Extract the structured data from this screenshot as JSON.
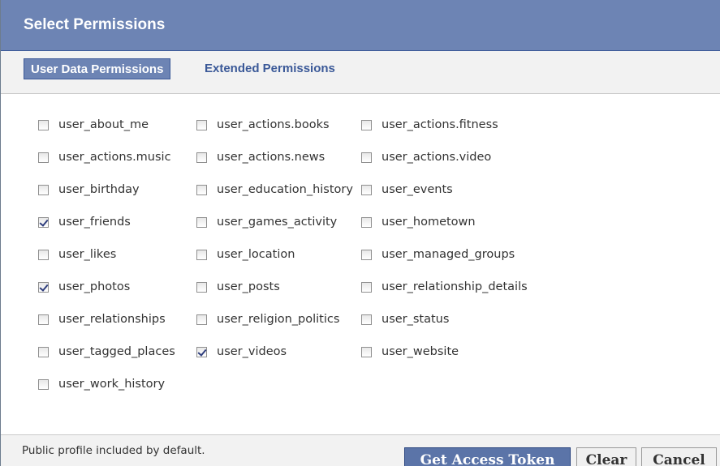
{
  "dialog": {
    "title": "Select Permissions"
  },
  "tabs": [
    {
      "label": "User Data Permissions",
      "active": true
    },
    {
      "label": "Extended Permissions",
      "active": false
    }
  ],
  "permissions": [
    {
      "label": "user_about_me",
      "checked": false
    },
    {
      "label": "user_actions.books",
      "checked": false
    },
    {
      "label": "user_actions.fitness",
      "checked": false
    },
    {
      "label": "user_actions.music",
      "checked": false
    },
    {
      "label": "user_actions.news",
      "checked": false
    },
    {
      "label": "user_actions.video",
      "checked": false
    },
    {
      "label": "user_birthday",
      "checked": false
    },
    {
      "label": "user_education_history",
      "checked": false
    },
    {
      "label": "user_events",
      "checked": false
    },
    {
      "label": "user_friends",
      "checked": true
    },
    {
      "label": "user_games_activity",
      "checked": false
    },
    {
      "label": "user_hometown",
      "checked": false
    },
    {
      "label": "user_likes",
      "checked": false
    },
    {
      "label": "user_location",
      "checked": false
    },
    {
      "label": "user_managed_groups",
      "checked": false
    },
    {
      "label": "user_photos",
      "checked": true
    },
    {
      "label": "user_posts",
      "checked": false
    },
    {
      "label": "user_relationship_details",
      "checked": false
    },
    {
      "label": "user_relationships",
      "checked": false
    },
    {
      "label": "user_religion_politics",
      "checked": false
    },
    {
      "label": "user_status",
      "checked": false
    },
    {
      "label": "user_tagged_places",
      "checked": false
    },
    {
      "label": "user_videos",
      "checked": true
    },
    {
      "label": "user_website",
      "checked": false
    },
    {
      "label": "user_work_history",
      "checked": false
    }
  ],
  "footer": {
    "note": "Public profile included by default.",
    "get_token_label": "Get Access Token",
    "clear_label": "Clear",
    "cancel_label": "Cancel"
  },
  "colors": {
    "header_bg": "#6d84b4",
    "accent": "#3b5998",
    "primary_button": "#5b74a8"
  }
}
